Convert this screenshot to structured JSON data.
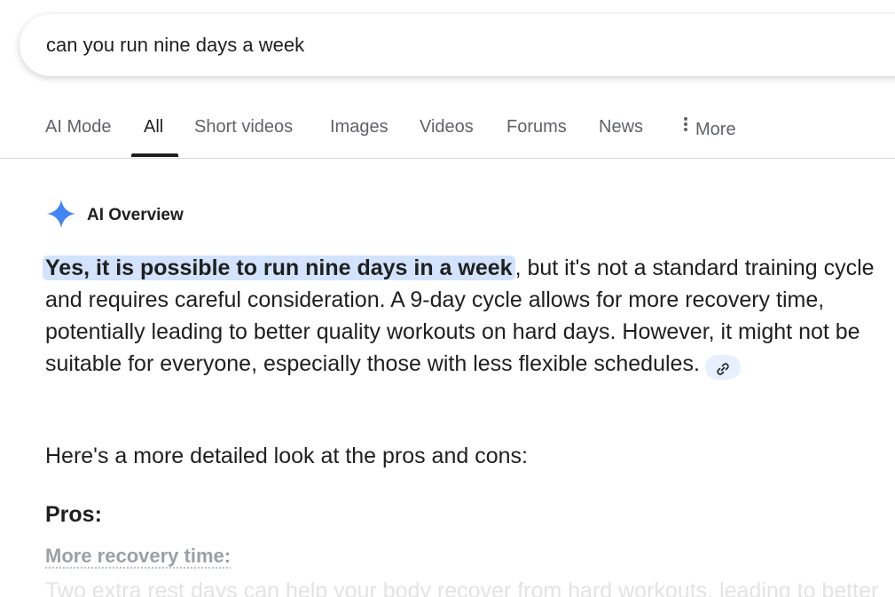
{
  "search": {
    "query": "can you run nine days a week"
  },
  "tabs": [
    {
      "label": "AI Mode",
      "active": false
    },
    {
      "label": "All",
      "active": true
    },
    {
      "label": "Short videos",
      "active": false
    },
    {
      "label": "Images",
      "active": false
    },
    {
      "label": "Videos",
      "active": false
    },
    {
      "label": "Forums",
      "active": false
    },
    {
      "label": "News",
      "active": false
    },
    {
      "label": "More",
      "active": false,
      "icon": "vertical-dots-icon"
    }
  ],
  "ai_overview": {
    "title": "AI Overview",
    "icon": "sparkle-icon",
    "accent_color": "#4285f4",
    "highlight_color": "#d3e3fd",
    "highlighted_text": "Yes, it is possible to run nine days in a week",
    "body_text": ", but it's not a standard training cycle and requires careful consideration. A 9-day cycle allows for more recovery time, potentially leading to better quality workouts on hard days. However, it might not be suitable for everyone, especially those with less flexible schedules.",
    "link_icon": "link-icon",
    "subheading": "Here's a more detailed look at the pros and cons:",
    "pros_label": "Pros:",
    "pro_items": [
      {
        "title": "More recovery time:",
        "text": "Two extra rest days can help your body recover from hard workouts, leading to better"
      }
    ]
  }
}
